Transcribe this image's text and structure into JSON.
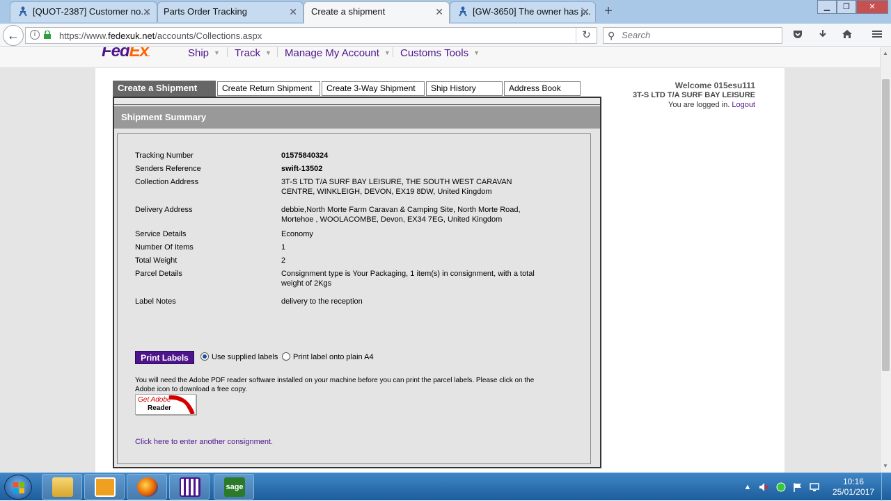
{
  "browser": {
    "tabs": [
      {
        "title": "[QUOT-2387] Customer no..."
      },
      {
        "title": "Parts Order Tracking"
      },
      {
        "title": "Create a shipment"
      },
      {
        "title": "[GW-3650] The owner has j..."
      }
    ],
    "url_prefix": "https://www.",
    "url_domain": "fedexuk.net",
    "url_path": "/accounts/Collections.aspx",
    "search_placeholder": "Search"
  },
  "site": {
    "nav": [
      "Ship",
      "Track",
      "Manage My Account",
      "Customs Tools"
    ],
    "tabs": [
      "Create a Shipment",
      "Create Return Shipment",
      "Create 3-Way Shipment",
      "Ship History",
      "Address Book"
    ],
    "welcome_title": "Welcome 015esu111",
    "company": "3T-S LTD T/A SURF BAY LEISURE",
    "logged_in_text": "You are logged in.",
    "logout": "Logout"
  },
  "summary": {
    "header": "Shipment Summary",
    "rows": [
      {
        "label": "Tracking Number",
        "value": "01575840324"
      },
      {
        "label": "Senders Reference",
        "value": "swift-13502"
      },
      {
        "label": "Collection Address",
        "value": "3T-S LTD T/A SURF BAY LEISURE, THE SOUTH WEST CARAVAN CENTRE, WINKLEIGH, DEVON, EX19 8DW, United Kingdom"
      },
      {
        "label": "Delivery Address",
        "value": "debbie,North Morte Farm Caravan & Camping Site, North Morte Road, Mortehoe , WOOLACOMBE, Devon, EX34 7EG, United Kingdom"
      },
      {
        "label": "Service Details",
        "value": "Economy"
      },
      {
        "label": "Number Of Items",
        "value": "1"
      },
      {
        "label": "Total Weight",
        "value": "2"
      },
      {
        "label": "Parcel Details",
        "value": "Consignment type is Your Packaging, 1 item(s) in consignment, with a total weight of 2Kgs"
      },
      {
        "label": "Label Notes",
        "value": "delivery to the reception"
      }
    ],
    "print_button": "Print Labels",
    "radio_supplied": "Use supplied labels",
    "radio_plain": "Print label onto plain A4",
    "adobe_note": "You will need the Adobe PDF reader software installed on your machine before you can print the parcel labels. Please click on the Adobe icon to download a free copy.",
    "adobe_get": "Get Adobe",
    "adobe_reader": "Reader",
    "another_link": "Click here to enter another consignment."
  },
  "taskbar": {
    "time": "10:16",
    "date": "25/01/2017"
  }
}
